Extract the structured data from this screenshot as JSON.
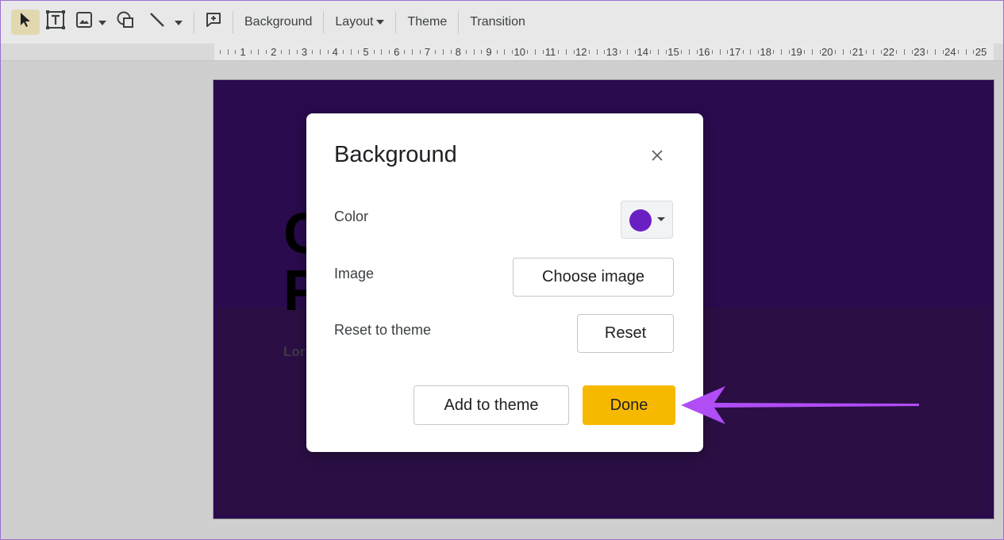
{
  "toolbar": {
    "items": [
      {
        "name": "select-tool-icon"
      },
      {
        "name": "text-box-icon"
      },
      {
        "name": "image-icon"
      },
      {
        "name": "shape-icon"
      },
      {
        "name": "line-icon"
      },
      {
        "name": "new-comment-icon"
      }
    ],
    "background_label": "Background",
    "layout_label": "Layout",
    "theme_label": "Theme",
    "transition_label": "Transition"
  },
  "ruler": {
    "numbers": [
      "1",
      "2",
      "3",
      "4",
      "5",
      "6",
      "7",
      "8",
      "9",
      "10",
      "11",
      "12",
      "13",
      "14",
      "15",
      "16",
      "17",
      "18",
      "19",
      "20",
      "21",
      "22",
      "23",
      "24",
      "25"
    ]
  },
  "slide": {
    "title_line1": "C",
    "title_line2": "P",
    "subtitle": "Lor",
    "bg_color": "#2a0b4e"
  },
  "dialog": {
    "title": "Background",
    "color_label": "Color",
    "color_value": "#6a1fc2",
    "image_label": "Image",
    "choose_image_label": "Choose image",
    "reset_row_label": "Reset to theme",
    "reset_label": "Reset",
    "add_to_theme_label": "Add to theme",
    "done_label": "Done"
  },
  "colors": {
    "accent": "#f7b900",
    "arrow": "#b04df5"
  }
}
